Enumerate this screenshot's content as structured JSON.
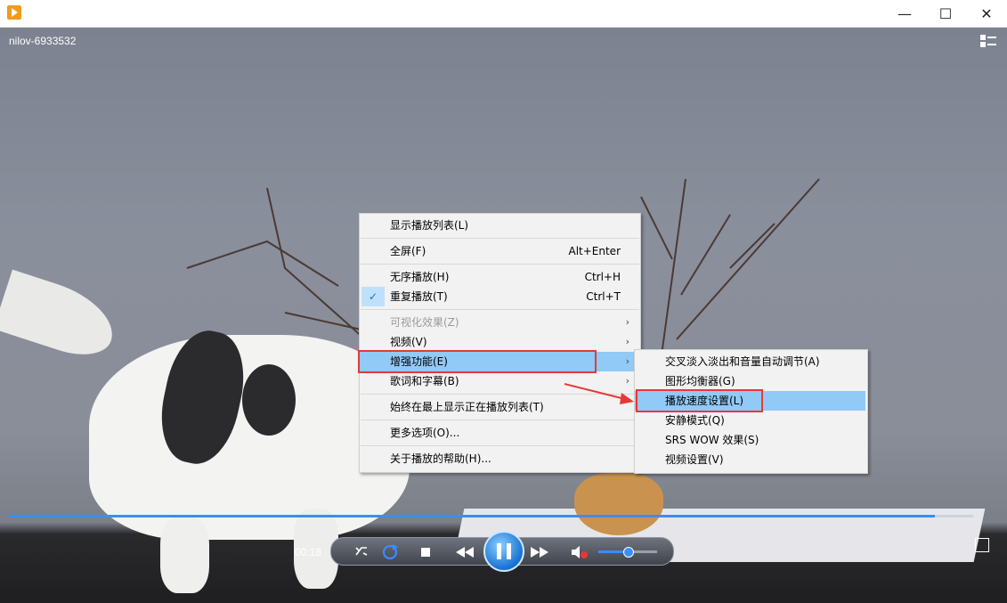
{
  "window": {
    "min_glyph": "—",
    "max_glyph": "☐",
    "close_glyph": "✕"
  },
  "player": {
    "video_title": "nilov-6933532",
    "current_time": "00:18",
    "progress_fraction": 0.96,
    "volume_fraction": 0.5
  },
  "context_menu": {
    "items": [
      {
        "label": "显示播放列表(L)",
        "shortcut": "",
        "submenu": false,
        "disabled": false
      },
      {
        "label": "全屏(F)",
        "shortcut": "Alt+Enter",
        "submenu": false,
        "disabled": false
      },
      {
        "label": "无序播放(H)",
        "shortcut": "Ctrl+H",
        "submenu": false,
        "disabled": false
      },
      {
        "label": "重复播放(T)",
        "shortcut": "Ctrl+T",
        "submenu": false,
        "disabled": false,
        "checked": true
      },
      {
        "label": "可视化效果(Z)",
        "shortcut": "",
        "submenu": true,
        "disabled": true
      },
      {
        "label": "视频(V)",
        "shortcut": "",
        "submenu": true,
        "disabled": false
      },
      {
        "label": "增强功能(E)",
        "shortcut": "",
        "submenu": true,
        "disabled": false,
        "highlighted": true
      },
      {
        "label": "歌词和字幕(B)",
        "shortcut": "",
        "submenu": true,
        "disabled": false
      },
      {
        "label": "始终在最上显示正在播放列表(T)",
        "shortcut": "",
        "submenu": false,
        "disabled": false
      },
      {
        "label": "更多选项(O)...",
        "shortcut": "",
        "submenu": false,
        "disabled": false
      },
      {
        "label": "关于播放的帮助(H)...",
        "shortcut": "",
        "submenu": false,
        "disabled": false
      }
    ]
  },
  "enhancements_submenu": {
    "items": [
      {
        "label": "交叉淡入淡出和音量自动调节(A)"
      },
      {
        "label": "图形均衡器(G)"
      },
      {
        "label": "播放速度设置(L)",
        "highlighted": true
      },
      {
        "label": "安静模式(Q)"
      },
      {
        "label": "SRS WOW 效果(S)"
      },
      {
        "label": "视频设置(V)"
      }
    ]
  },
  "colors": {
    "highlight": "#91c9f7",
    "annotation_red": "#e53935",
    "accent_blue": "#3b8cff"
  },
  "icons": {
    "check": "✓",
    "submenu_arrow": "›"
  }
}
